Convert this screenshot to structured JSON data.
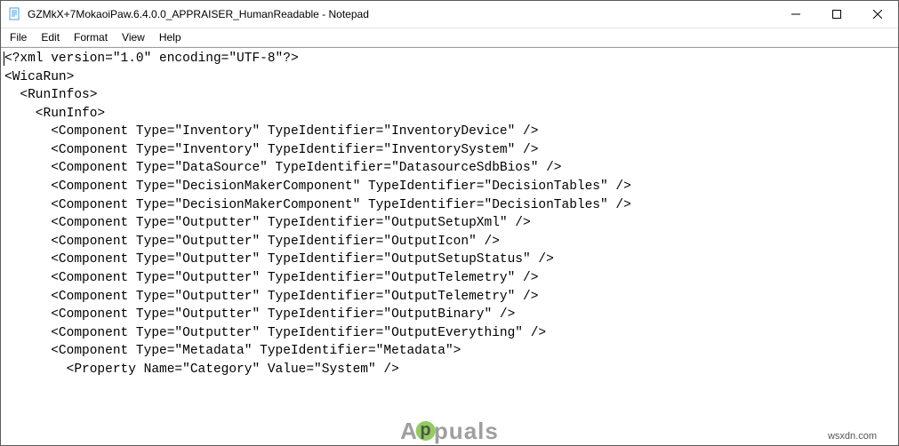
{
  "window": {
    "title": "GZMkX+7MokaoiPaw.6.4.0.0_APPRAISER_HumanReadable - Notepad"
  },
  "menu": {
    "file": "File",
    "edit": "Edit",
    "format": "Format",
    "view": "View",
    "help": "Help"
  },
  "editor": {
    "lines": [
      "<?xml version=\"1.0\" encoding=\"UTF-8\"?>",
      "<WicaRun>",
      "  <RunInfos>",
      "    <RunInfo>",
      "      <Component Type=\"Inventory\" TypeIdentifier=\"InventoryDevice\" />",
      "      <Component Type=\"Inventory\" TypeIdentifier=\"InventorySystem\" />",
      "      <Component Type=\"DataSource\" TypeIdentifier=\"DatasourceSdbBios\" />",
      "      <Component Type=\"DecisionMakerComponent\" TypeIdentifier=\"DecisionTables\" />",
      "      <Component Type=\"DecisionMakerComponent\" TypeIdentifier=\"DecisionTables\" />",
      "      <Component Type=\"Outputter\" TypeIdentifier=\"OutputSetupXml\" />",
      "      <Component Type=\"Outputter\" TypeIdentifier=\"OutputIcon\" />",
      "      <Component Type=\"Outputter\" TypeIdentifier=\"OutputSetupStatus\" />",
      "      <Component Type=\"Outputter\" TypeIdentifier=\"OutputTelemetry\" />",
      "      <Component Type=\"Outputter\" TypeIdentifier=\"OutputTelemetry\" />",
      "      <Component Type=\"Outputter\" TypeIdentifier=\"OutputBinary\" />",
      "      <Component Type=\"Outputter\" TypeIdentifier=\"OutputEverything\" />",
      "      <Component Type=\"Metadata\" TypeIdentifier=\"Metadata\">",
      "        <Property Name=\"Category\" Value=\"System\" />"
    ]
  },
  "watermark": "wsxdn.com",
  "logo": {
    "pre": "A",
    "mid": "p",
    "post": "puals"
  }
}
